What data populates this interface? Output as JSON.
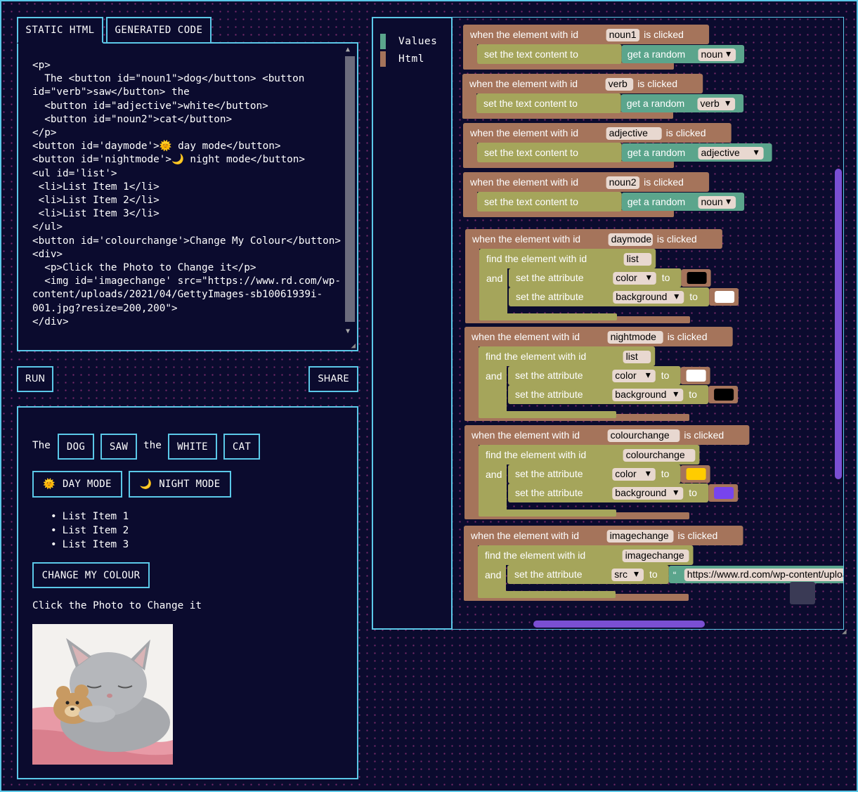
{
  "tabs": {
    "static_html": "STATIC HTML",
    "generated_code": "GENERATED CODE"
  },
  "code": "<p>\n  The <button id=\"noun1\">dog</button> <button id=\"verb\">saw</button> the\n  <button id=\"adjective\">white</button>\n  <button id=\"noun2\">cat</button>\n</p>\n<button id='daymode'>🌞 day mode</button>\n<button id='nightmode'>🌙 night mode</button>\n<ul id='list'>\n <li>List Item 1</li>\n <li>List Item 2</li>\n <li>List Item 3</li>\n</ul>\n<button id='colourchange'>Change My Colour</button>\n<div>\n  <p>Click the Photo to Change it</p>\n  <img id='imagechange' src=\"https://www.rd.com/wp-content/uploads/2021/04/GettyImages-sb10061939i-001.jpg?resize=200,200\">\n</div>",
  "buttons": {
    "run": "RUN",
    "share": "SHARE"
  },
  "output": {
    "the1": "The",
    "noun1": "DOG",
    "verb": "SAW",
    "the2": "the",
    "adjective": "WHITE",
    "noun2": "CAT",
    "day_icon": "🌞",
    "day_mode": "DAY MODE",
    "night_icon": "🌙",
    "night_mode": "NIGHT MODE",
    "list_items": [
      "List Item 1",
      "List Item 2",
      "List Item 3"
    ],
    "colour_button": "CHANGE MY COLOUR",
    "photo_caption": "Click the Photo to Change it",
    "photo_subject": "sleeping grey kitten with teddy bear"
  },
  "toolbox": {
    "categories": [
      {
        "label": "Values",
        "color": "#5ba58c"
      },
      {
        "label": "Html",
        "color": "#a5745b"
      }
    ]
  },
  "blocks": {
    "colors": {
      "event": "#a5745b",
      "statement": "#a5a55b",
      "value": "#5ba58c",
      "field": "#e8d8d0"
    },
    "when_prefix": "when the element with id",
    "when_suffix": "is clicked",
    "set_text": "set the text content to",
    "get_random": "get a random",
    "find_element": "find the element with id",
    "and": "and",
    "set_attribute": "set the attribute",
    "to": "to",
    "quote_glyph": "“",
    "events": [
      {
        "id": "noun1",
        "random": "noun"
      },
      {
        "id": "verb",
        "random": "verb"
      },
      {
        "id": "adjective",
        "random": "adjective"
      },
      {
        "id": "noun2",
        "random": "noun"
      },
      {
        "id": "daymode",
        "target": "list",
        "attrs": [
          {
            "name": "color",
            "value": "#000000"
          },
          {
            "name": "background",
            "value": "#ffffff"
          }
        ]
      },
      {
        "id": "nightmode",
        "target": "list",
        "attrs": [
          {
            "name": "color",
            "value": "#ffffff"
          },
          {
            "name": "background",
            "value": "#000000"
          }
        ]
      },
      {
        "id": "colourchange",
        "target": "colourchange",
        "attrs": [
          {
            "name": "color",
            "value": "#ffcc00"
          },
          {
            "name": "background",
            "value": "#7744ee"
          }
        ]
      },
      {
        "id": "imagechange",
        "target": "imagechange",
        "attrs": [
          {
            "name": "src",
            "text": "https://www.rd.com/wp-content/uploa"
          }
        ]
      }
    ]
  }
}
